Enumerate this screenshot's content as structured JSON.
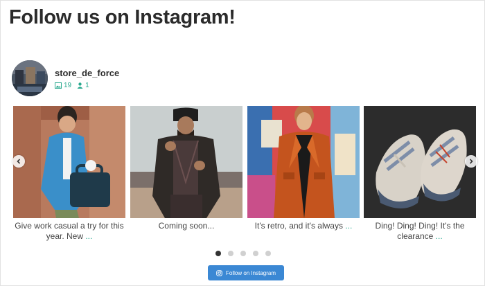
{
  "header": {
    "title": "Follow us on Instagram!"
  },
  "profile": {
    "username": "store_de_force",
    "posts_count": "19",
    "followers_count": "1",
    "avatar_icon": "avatar-photo"
  },
  "feed": {
    "posts": [
      {
        "caption": "Give work casual a try for this year. New",
        "more": "..."
      },
      {
        "caption": "Coming soon...",
        "more": ""
      },
      {
        "caption": "It's retro, and it's always",
        "more": "..."
      },
      {
        "caption": "Ding! Ding! Ding! It's the clearance",
        "more": "..."
      }
    ],
    "prev_icon": "chevron-left-icon",
    "next_icon": "chevron-right-icon"
  },
  "pagination": {
    "total": 5,
    "active": 1
  },
  "follow_button": {
    "label": "Follow on Instagram",
    "color": "#3b88d4"
  },
  "colors": {
    "accent": "#2aa98f",
    "button": "#3b88d4"
  }
}
